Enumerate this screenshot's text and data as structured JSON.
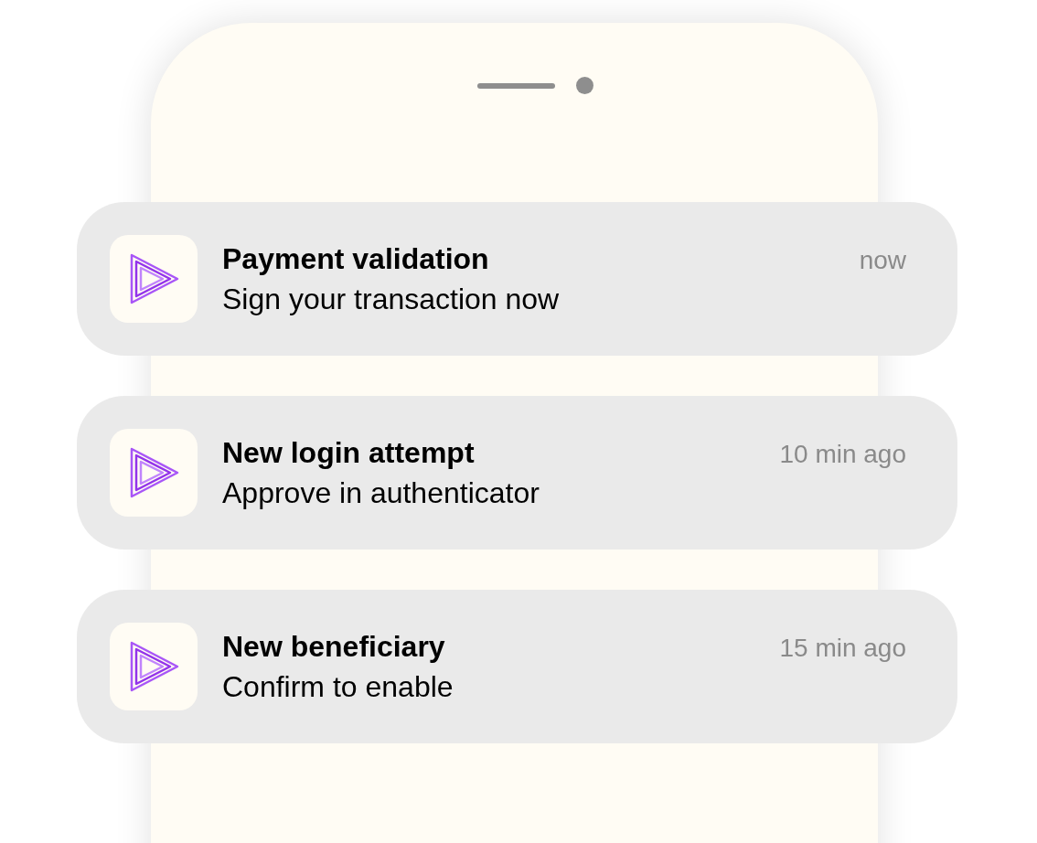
{
  "notifications": [
    {
      "title": "Payment validation",
      "body": "Sign your transaction now",
      "time": "now"
    },
    {
      "title": "New login attempt",
      "body": "Approve in authenticator",
      "time": "10 min ago"
    },
    {
      "title": "New beneficiary",
      "body": "Confirm to enable",
      "time": "15 min ago"
    }
  ]
}
